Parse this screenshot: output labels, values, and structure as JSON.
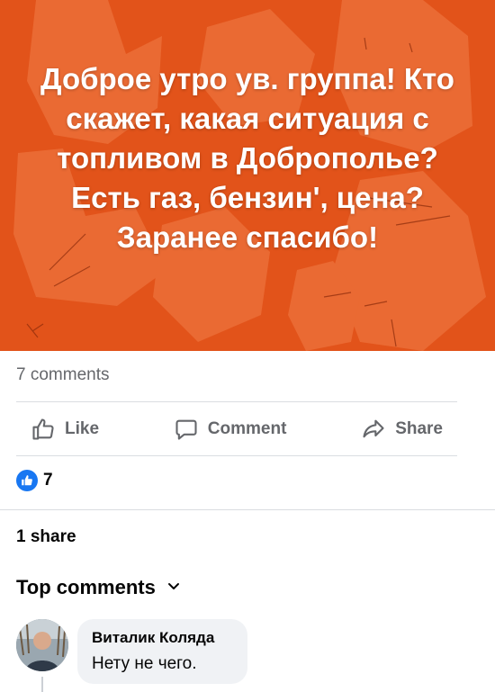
{
  "post": {
    "text": "Доброе утро ув. группа! Кто скажет, какая ситуация с топливом в Доброполье? Есть газ, бензин', цена? Заранее спасибо!",
    "background_color": "#e2531a"
  },
  "stats": {
    "comments": "7 comments",
    "reactions": "7",
    "shares": "1 share"
  },
  "actions": {
    "like": "Like",
    "comment": "Comment",
    "share": "Share"
  },
  "comments_section": {
    "title": "Top comments",
    "items": [
      {
        "author": "Виталик Коляда",
        "text": "Нету не чего."
      }
    ]
  },
  "colors": {
    "accent": "#1877f2",
    "muted_text": "#65676b",
    "bubble": "#f0f2f5"
  },
  "icons": [
    "thumbs-up-icon",
    "comment-bubble-icon",
    "share-arrow-icon",
    "like-reaction-icon",
    "chevron-down-icon"
  ]
}
